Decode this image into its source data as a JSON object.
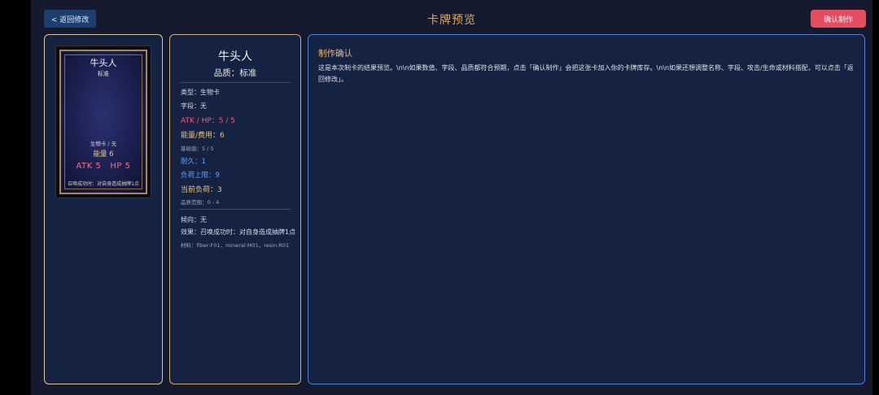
{
  "header": {
    "back_label": "< 返回修改",
    "title": "卡牌预览",
    "confirm_label": "确认制作"
  },
  "card_preview": {
    "name": "牛头人",
    "quality": "标准",
    "type_line": "生物卡 / 无",
    "energy_line": "能量 6",
    "atk_hp_line": "ATK 5   HP 5",
    "effect_line": "召唤成功时：对自身造成抽牌1点"
  },
  "stats": {
    "name": "牛头人",
    "quality_line": "品质：标准",
    "type": "类型：生物卡",
    "field": "字段：无",
    "atk_hp": "ATK / HP：5 / 5",
    "energy_cost": "能量/费用：6",
    "base_value": "基础值：5 / 5",
    "durability": "耐久：1",
    "load_limit": "负荷上限：9",
    "current_load": "当前负荷：3",
    "quality_range": "品质范围：0 - 4",
    "tendency": "倾向：无",
    "effect": "效果：召唤成功时：对自身造成抽牌1点",
    "materials": "材料：fiber:F01，mineral:M01，resin:R01"
  },
  "confirm": {
    "title": "制作确认",
    "text": "这是本次制卡的结果预览。\\n\\n如果数值、字段、品质都符合预期，点击「确认制作」会把这张卡加入你的卡牌库存。\\n\\n如果还想调整名称、字段、攻击/生命或材料搭配，可以点击「返回修改」。"
  }
}
